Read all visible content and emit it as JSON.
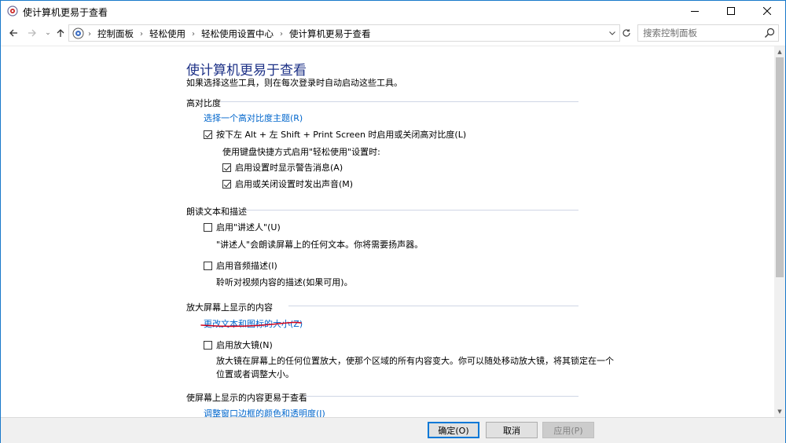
{
  "window": {
    "title": "使计算机更易于查看"
  },
  "address": {
    "crumbs": [
      "控制面板",
      "轻松使用",
      "轻松使用设置中心",
      "使计算机更易于查看"
    ],
    "search_placeholder": "搜索控制面板"
  },
  "page": {
    "title": "使计算机更易于查看",
    "subtitle": "如果选择这些工具，则在每次登录时自动启动这些工具。"
  },
  "sections": {
    "high_contrast": {
      "title": "高对比度",
      "link": "选择一个高对比度主题(R)",
      "toggle_label": "按下左 Alt + 左 Shift + Print Screen 时启用或关闭高对比度(L)",
      "toggle_checked": true,
      "keyboard_note": "使用键盘快捷方式启用\"轻松使用\"设置时:",
      "warning_label": "启用设置时显示警告消息(A)",
      "warning_checked": true,
      "sound_label": "启用或关闭设置时发出声音(M)",
      "sound_checked": true
    },
    "narration": {
      "title": "朗读文本和描述",
      "narrator_label": "启用\"讲述人\"(U)",
      "narrator_checked": false,
      "narrator_desc": "\"讲述人\"会朗读屏幕上的任何文本。你将需要扬声器。",
      "audio_label": "启用音频描述(I)",
      "audio_checked": false,
      "audio_desc": "聆听对视频内容的描述(如果可用)。"
    },
    "magnify": {
      "title": "放大屏幕上显示的内容",
      "link": "更改文本和图标的大小(Z)",
      "magnifier_label": "启用放大镜(N)",
      "magnifier_checked": false,
      "magnifier_desc": "放大镜在屏幕上的任何位置放大，使那个区域的所有内容变大。你可以随处移动放大镜，将其锁定在一个位置或者调整大小。"
    },
    "easier": {
      "title": "使屏幕上显示的内容更易于查看",
      "link": "调整窗口边框的颜色和透明度(J)"
    }
  },
  "buttons": {
    "ok": "确定(O)",
    "cancel": "取消",
    "apply": "应用(P)"
  },
  "colors": {
    "title_blue": "#1e3287",
    "link_blue": "#0066cc",
    "annotation_red": "#d0021b"
  }
}
